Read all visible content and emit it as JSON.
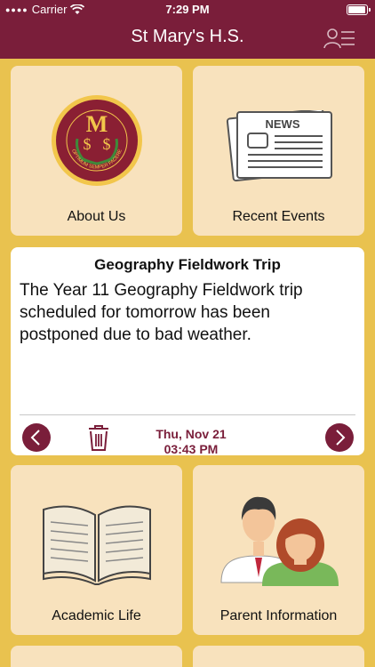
{
  "status_bar": {
    "carrier": "Carrier",
    "time": "7:29 PM"
  },
  "header": {
    "title": "St Mary's H.S."
  },
  "logo": {
    "motto": "OPTIMUM SEMPER FACERE"
  },
  "tiles": {
    "about": {
      "label": "About Us",
      "icon": "school-crest-icon"
    },
    "events": {
      "label": "Recent Events",
      "icon": "newspaper-icon",
      "news_text": "NEWS"
    },
    "academic": {
      "label": "Academic Life",
      "icon": "open-book-icon"
    },
    "parents": {
      "label": "Parent Information",
      "icon": "parents-icon"
    }
  },
  "message": {
    "title": "Geography Fieldwork Trip",
    "body": "The Year 11 Geography Fieldwork trip scheduled for tomorrow has been postponed due to bad weather.",
    "date_line1": "Thu, Nov 21",
    "date_line2": "03:43 PM"
  },
  "colors": {
    "primary": "#7a1e3a",
    "background": "#e9c24f",
    "tile": "#f8e2bd"
  }
}
